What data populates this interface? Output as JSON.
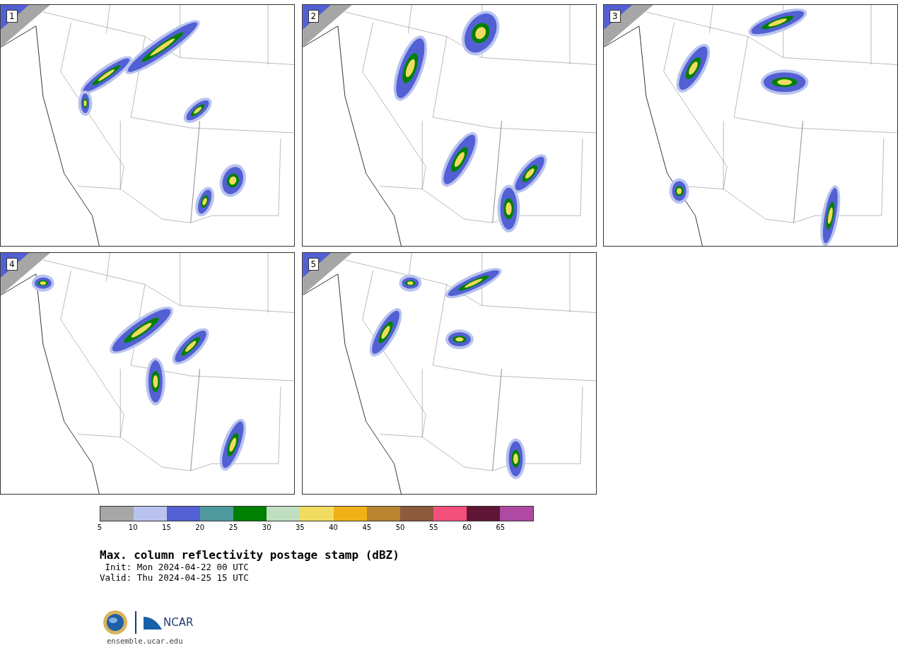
{
  "panels": [
    {
      "number": "1"
    },
    {
      "number": "2"
    },
    {
      "number": "3"
    },
    {
      "number": "4"
    },
    {
      "number": "5"
    }
  ],
  "colorbar": {
    "segments": [
      {
        "color": "#a6a6a6"
      },
      {
        "color": "#b9c3ee"
      },
      {
        "color": "#5260d4"
      },
      {
        "color": "#50999c"
      },
      {
        "color": "#008000"
      },
      {
        "color": "#c0dfc0"
      },
      {
        "color": "#f0dc60"
      },
      {
        "color": "#f0b018"
      },
      {
        "color": "#b88430"
      },
      {
        "color": "#8c5a3c"
      },
      {
        "color": "#f4507c"
      },
      {
        "color": "#5e1634"
      },
      {
        "color": "#ae4aa2"
      }
    ],
    "ticks": [
      "5",
      "10",
      "15",
      "20",
      "25",
      "30",
      "35",
      "40",
      "45",
      "50",
      "55",
      "60",
      "65"
    ]
  },
  "title": "Max. column reflectivity postage stamp (dBZ)",
  "init": " Init: Mon 2024-04-22 00 UTC",
  "valid": "Valid: Thu 2024-04-25 15 UTC",
  "logo": {
    "org": "NCAR",
    "url": "ensemble.ucar.edu"
  }
}
